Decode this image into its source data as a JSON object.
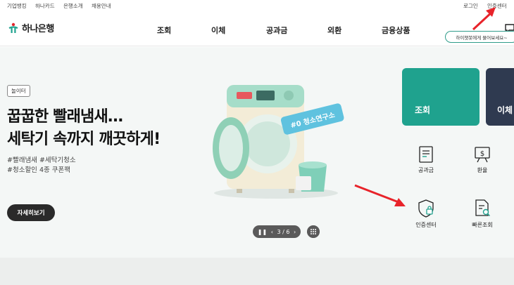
{
  "util_left": [
    "기업뱅킹",
    "하나카드",
    "은행소개",
    "채용안내"
  ],
  "util_right": [
    "로그인",
    "인증센터"
  ],
  "logo": "하나은행",
  "gnb": [
    "조회",
    "이체",
    "공과금",
    "외환",
    "금융상품"
  ],
  "chat_tip": "하이챗봇에게 물어보세요~",
  "hero": {
    "tag": "놀이터",
    "headline_1": "꿉꿉한 빨래냄새…",
    "headline_2": "세탁기 속까지 깨끗하게!",
    "hash_1": "#빨래냄새 #세탁기청소",
    "hash_2": "#청소할인 4종 쿠폰팩",
    "button": "자세히보기",
    "illust_tag": "#0 청소연구소"
  },
  "pager": {
    "current": "3",
    "total": "6",
    "separator": "/"
  },
  "quick_cards": [
    "조회",
    "이체"
  ],
  "quick_icons": [
    "공과금",
    "환율",
    "인증센터",
    "빠른조회"
  ],
  "colors": {
    "brand": "#1fa28e",
    "navy": "#2f3a50",
    "annotation_arrow": "#e8232a"
  }
}
